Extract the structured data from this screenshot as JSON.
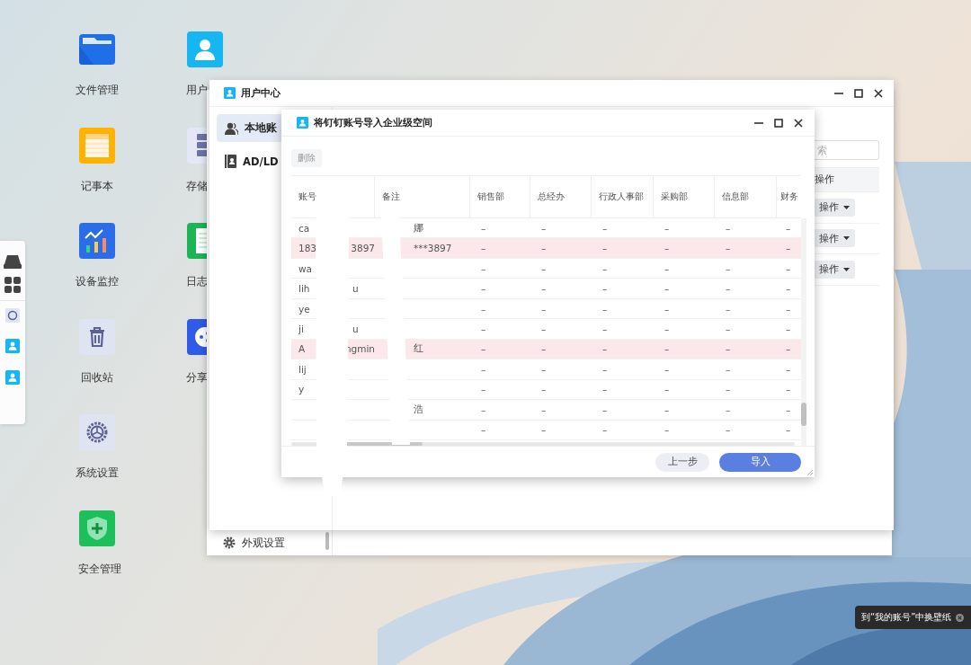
{
  "desktop_icons": [
    {
      "label": "文件管理",
      "kind": "folder"
    },
    {
      "label": "记事本",
      "kind": "notepad"
    },
    {
      "label": "设备监控",
      "kind": "monitor"
    },
    {
      "label": "回收站",
      "kind": "trash"
    },
    {
      "label": "系统设置",
      "kind": "settings"
    },
    {
      "label": "安全管理",
      "kind": "security"
    },
    {
      "label": "用户",
      "kind": "user"
    },
    {
      "label": "存储",
      "kind": "storage"
    },
    {
      "label": "日志",
      "kind": "log"
    },
    {
      "label": "分享",
      "kind": "share"
    }
  ],
  "background_window": {
    "menu_item": "外观设置"
  },
  "user_center": {
    "title": "用户中心",
    "sidebar": [
      {
        "label": "本地账",
        "kind": "users",
        "selected": true
      },
      {
        "label": "AD/LD",
        "kind": "directory",
        "selected": false
      }
    ],
    "search": {
      "placeholder": "索"
    },
    "table": {
      "column_header": "操作",
      "row_actions": [
        "操作",
        "操作",
        "操作"
      ]
    }
  },
  "dialog": {
    "title": "将钉钉账号导入企业级空间",
    "delete_button": {
      "label": "删除",
      "disabled": true
    },
    "columns": [
      "账号",
      "备注",
      "销售部",
      "总经办",
      "行政人事部",
      "采购部",
      "信息部",
      "财务"
    ],
    "rows": [
      {
        "account_parts": [
          "ca"
        ],
        "note": "娜",
        "highlighted": false,
        "departments": [
          "–",
          "–",
          "–",
          "–",
          "–",
          "–"
        ]
      },
      {
        "account_parts": [
          "183",
          "3897"
        ],
        "note": "***3897",
        "highlighted": true,
        "departments": [
          "–",
          "–",
          "–",
          "–",
          "–",
          "–"
        ]
      },
      {
        "account_parts": [
          "wa"
        ],
        "highlighted": false,
        "departments": [
          "–",
          "–",
          "–",
          "–",
          "–",
          "–"
        ]
      },
      {
        "account_parts": [
          "lih",
          "u"
        ],
        "highlighted": false,
        "departments": [
          "–",
          "–",
          "–",
          "–",
          "–",
          "–"
        ]
      },
      {
        "account_parts": [
          "ye"
        ],
        "highlighted": false,
        "departments": [
          "–",
          "–",
          "–",
          "–",
          "–",
          "–"
        ]
      },
      {
        "account_parts": [
          "ji",
          "u"
        ],
        "highlighted": false,
        "departments": [
          "–",
          "–",
          "–",
          "–",
          "–",
          "–"
        ]
      },
      {
        "account_parts": [
          "A",
          "ngmin"
        ],
        "note": "红",
        "highlighted": true,
        "departments": [
          "–",
          "–",
          "–",
          "–",
          "–",
          "–"
        ]
      },
      {
        "account_parts": [
          "lij"
        ],
        "highlighted": false,
        "departments": [
          "–",
          "–",
          "–",
          "–",
          "–",
          "–"
        ]
      },
      {
        "account_parts": [
          "y"
        ],
        "highlighted": false,
        "departments": [
          "–",
          "–",
          "–",
          "–",
          "–",
          "–"
        ]
      },
      {
        "note": "浩",
        "highlighted": false,
        "departments": [
          "–",
          "–",
          "–",
          "–",
          "–",
          "–"
        ]
      },
      {
        "highlighted": false,
        "departments": [
          "–",
          "–",
          "–",
          "–",
          "–",
          "–"
        ]
      }
    ],
    "buttons": [
      {
        "label": "上一步",
        "kind": "secondary"
      },
      {
        "label": "导入",
        "kind": "primary"
      }
    ]
  },
  "toast": {
    "text": "到“我的账号”中换壁纸"
  }
}
